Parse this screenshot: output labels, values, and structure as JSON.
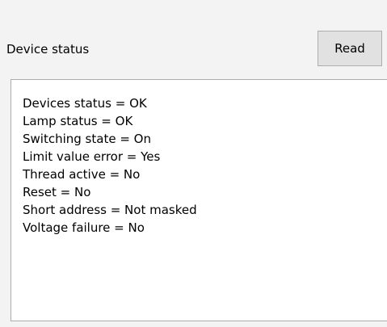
{
  "device_status": {
    "label": "Device status",
    "read_label": "Read",
    "lines": [
      "Devices status = OK",
      "Lamp status = OK",
      "Switching state = On",
      "Limit value error = Yes",
      "Thread active = No",
      "Reset = No",
      "Short address = Not masked",
      "Voltage failure = No"
    ]
  }
}
